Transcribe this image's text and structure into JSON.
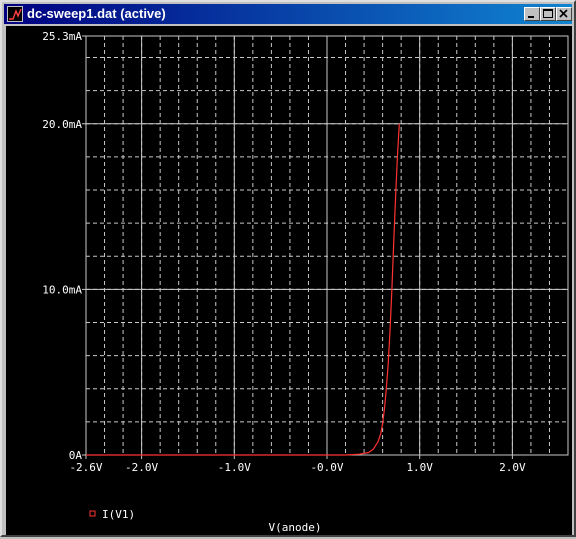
{
  "window": {
    "title": "dc-sweep1.dat (active)",
    "icon": "probe-icon",
    "controls": [
      "minimize-icon",
      "maximize-icon",
      "close-icon"
    ]
  },
  "colors": {
    "plot_background": "#000000",
    "grid": "#c8c8c8",
    "axis_text": "#ffffff",
    "trace": "#ff3333",
    "title_bar": "#000080"
  },
  "chart_data": {
    "type": "line",
    "xlabel": "V(anode)",
    "ylabel": "",
    "xlim": [
      -2.6,
      2.6
    ],
    "ylim": [
      0,
      25.3
    ],
    "y_unit": "mA",
    "x_ticks": [
      -2.6,
      -2.0,
      -1.0,
      0.0,
      1.0,
      2.0
    ],
    "x_tick_labels": [
      "-2.6V",
      "-2.0V",
      "-1.0V",
      "-0.0V",
      "1.0V",
      "2.0V"
    ],
    "y_ticks": [
      0,
      10.0,
      20.0,
      25.3
    ],
    "y_tick_labels": [
      "0A",
      "10.0mA",
      "20.0mA",
      "25.3mA"
    ],
    "grid": true,
    "legend_position": "bottom-left",
    "series": [
      {
        "name": "I(V1)",
        "color": "#ff3333",
        "x": [
          -2.6,
          -2.0,
          -1.0,
          0.0,
          0.2,
          0.35,
          0.45,
          0.5,
          0.55,
          0.58,
          0.6,
          0.62,
          0.64,
          0.66,
          0.68,
          0.7,
          0.72,
          0.74,
          0.76,
          0.78
        ],
        "y": [
          0,
          0,
          0,
          0,
          0.0,
          0.05,
          0.15,
          0.35,
          0.8,
          1.3,
          1.9,
          2.8,
          4.0,
          5.5,
          7.5,
          10.0,
          12.8,
          15.6,
          18.0,
          20.0
        ]
      }
    ]
  }
}
